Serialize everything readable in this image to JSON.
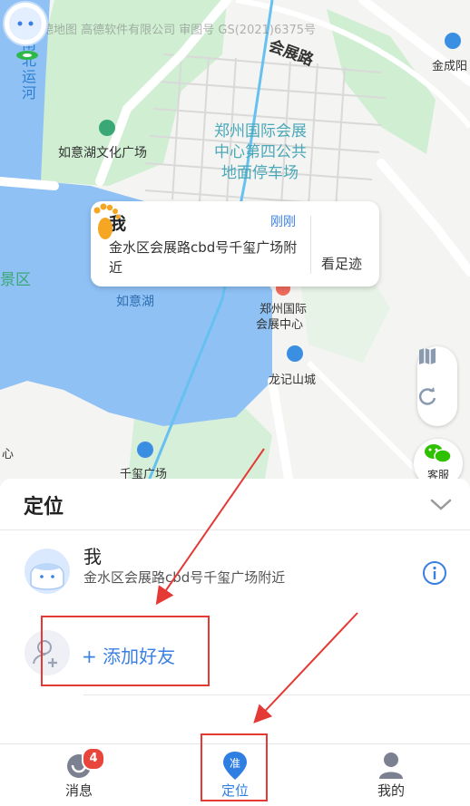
{
  "map": {
    "watermark": "©高德地图 高德软件有限公司 审图号 GS(2021)6375号",
    "labels": {
      "road_huizhan": "会展路",
      "nanbei_canal": "南北运河",
      "ruyihu_culture": "如意湖文化广场",
      "parking": [
        "郑州国际会展",
        "中心第四公共",
        "地面停车场"
      ],
      "jingqu": "景区",
      "ruyihu": "如意湖",
      "expo_center": [
        "郑州国际",
        "会展中心"
      ],
      "longji": "龙记山城",
      "qianxi_square": "千玺广场",
      "jincheng": "金成阳",
      "left_edge": "心"
    }
  },
  "bubble": {
    "name": "我",
    "time": "刚刚",
    "address": "金水区会展路cbd号千玺广场附近",
    "footprint_label": "看足迹"
  },
  "controls": {
    "map_icon": "map-layers-icon",
    "refresh_icon": "refresh-icon",
    "service_label": "客服"
  },
  "panel": {
    "title": "定位",
    "me": {
      "name": "我",
      "address": "金水区会展路cbd号千玺广场附近"
    },
    "add_friend": "+ 添加好友"
  },
  "tabs": [
    {
      "label": "消息",
      "badge": "4",
      "icon": "message-icon"
    },
    {
      "label": "定位",
      "icon": "location-pin-icon",
      "icon_text": "准"
    },
    {
      "label": "我的",
      "icon": "user-icon"
    }
  ],
  "colors": {
    "accent": "#3a7fe3",
    "water": "#8fc1f5",
    "green": "#cfeed2",
    "annotation": "#e53935",
    "badge": "#e8453c"
  }
}
